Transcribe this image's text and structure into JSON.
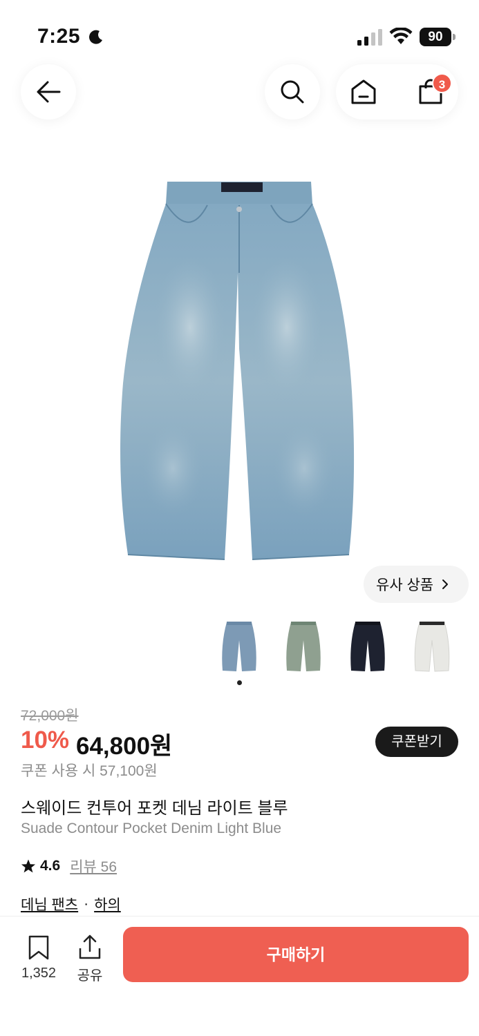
{
  "status_bar": {
    "time": "7:25",
    "battery": "90"
  },
  "nav": {
    "cart_count": "3"
  },
  "similar": {
    "label": "유사 상품"
  },
  "product": {
    "original_price": "72,000원",
    "discount": "10%",
    "price": "64,800원",
    "coupon_button": "쿠폰받기",
    "coupon_price": "쿠폰 사용 시 57,100원",
    "title_ko": "스웨이드 컨투어 포켓 데님 라이트 블루",
    "title_en": "Suade Contour Pocket Denim Light Blue",
    "rating": "4.6",
    "reviews": "리뷰 56",
    "categories": [
      "데님 팬츠",
      "하의"
    ],
    "category_separator": "·"
  },
  "thumbnails": [
    {
      "color": "#7d9ab5"
    },
    {
      "color": "#8fa090"
    },
    {
      "color": "#1e2230"
    },
    {
      "color": "#e8e8e4"
    }
  ],
  "bottom_bar": {
    "bookmark_count": "1,352",
    "share_label": "공유",
    "buy_label": "구매하기"
  },
  "colors": {
    "accent": "#ef5f52",
    "discount": "#ef5a4b"
  }
}
